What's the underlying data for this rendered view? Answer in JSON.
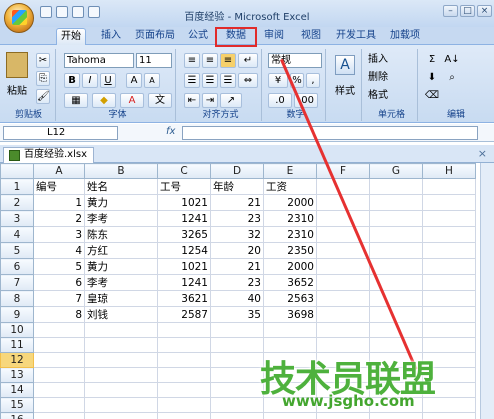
{
  "window": {
    "title": "百度经验 - Microsoft Excel",
    "controls": [
      "–",
      "□",
      "×"
    ]
  },
  "ribbon_tabs": [
    "开始",
    "插入",
    "页面布局",
    "公式",
    "数据",
    "审阅",
    "视图",
    "开发工具",
    "加载项"
  ],
  "ribbon": {
    "clipboard": {
      "paste": "粘贴",
      "label": "剪贴板"
    },
    "font": {
      "name": "Tahoma",
      "size": "11",
      "bold": "B",
      "italic": "I",
      "underline": "U",
      "grow": "A",
      "shrink": "A",
      "label": "字体"
    },
    "alignment": {
      "label": "对齐方式"
    },
    "number": {
      "format": "常规",
      "percent": "%",
      "comma": ",",
      "label": "数字"
    },
    "styles": {
      "label": "样式"
    },
    "cells": {
      "insert": "插入",
      "delete": "删除",
      "format": "格式",
      "label": "单元格"
    },
    "editing": {
      "label": "编辑",
      "sigma": "Σ"
    }
  },
  "formula_bar": {
    "name_box": "L12",
    "fx": "fx",
    "value": ""
  },
  "workbook_tab": "百度经验.xlsx",
  "columns": [
    "A",
    "B",
    "C",
    "D",
    "E",
    "F",
    "G",
    "H"
  ],
  "rows": [
    [
      "编号",
      "姓名",
      "工号",
      "年龄",
      "工资",
      "",
      "",
      ""
    ],
    [
      "1",
      "黄力",
      "1021",
      "21",
      "2000",
      "",
      "",
      ""
    ],
    [
      "2",
      "李考",
      "1241",
      "23",
      "2310",
      "",
      "",
      ""
    ],
    [
      "3",
      "陈东",
      "3265",
      "32",
      "2310",
      "",
      "",
      ""
    ],
    [
      "4",
      "方红",
      "1254",
      "20",
      "2350",
      "",
      "",
      ""
    ],
    [
      "5",
      "黄力",
      "1021",
      "21",
      "2000",
      "",
      "",
      ""
    ],
    [
      "6",
      "李考",
      "1241",
      "23",
      "3652",
      "",
      "",
      ""
    ],
    [
      "7",
      "皇琼",
      "3621",
      "40",
      "2563",
      "",
      "",
      ""
    ],
    [
      "8",
      "刘钱",
      "2587",
      "35",
      "3698",
      "",
      "",
      ""
    ],
    [
      "",
      "",
      "",
      "",
      "",
      "",
      "",
      ""
    ],
    [
      "",
      "",
      "",
      "",
      "",
      "",
      "",
      ""
    ],
    [
      "",
      "",
      "",
      "",
      "",
      "",
      "",
      ""
    ],
    [
      "",
      "",
      "",
      "",
      "",
      "",
      "",
      ""
    ],
    [
      "",
      "",
      "",
      "",
      "",
      "",
      "",
      ""
    ],
    [
      "",
      "",
      "",
      "",
      "",
      "",
      "",
      ""
    ],
    [
      "",
      "",
      "",
      "",
      "",
      "",
      "",
      ""
    ]
  ],
  "row_numbers": [
    "1",
    "2",
    "3",
    "4",
    "5",
    "6",
    "7",
    "8",
    "9",
    "10",
    "11",
    "12",
    "13",
    "14",
    "15",
    "16"
  ],
  "selected_row": "12",
  "annotation": {
    "highlight_color": "#e12b2b"
  },
  "watermark": {
    "text": "技术员联盟",
    "url": "www.jsgho.com"
  }
}
